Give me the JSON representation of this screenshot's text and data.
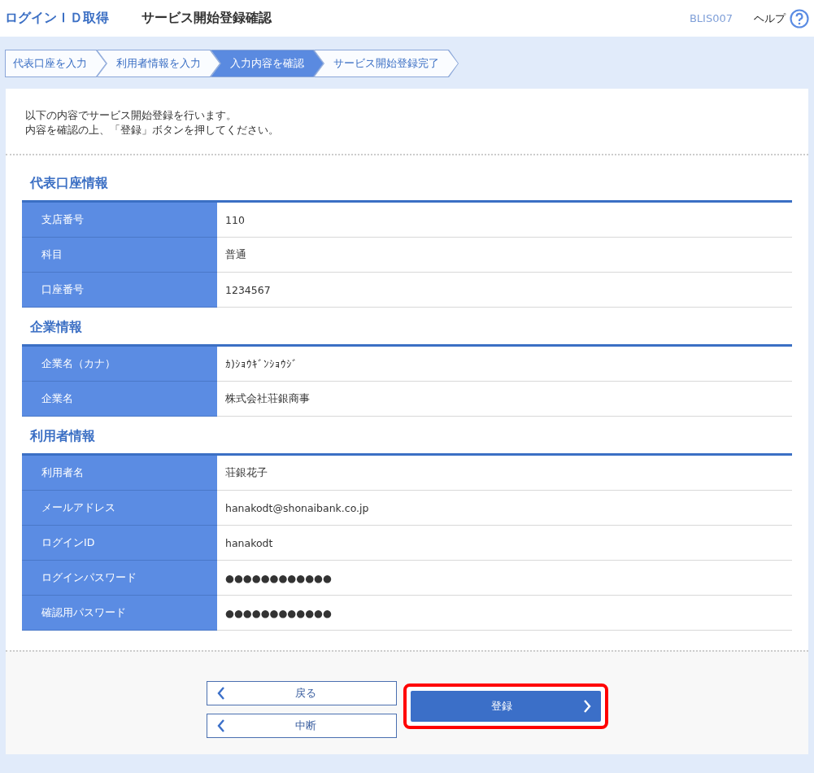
{
  "header": {
    "title": "ログインＩＤ取得",
    "subtitle": "サービス開始登録確認",
    "screen_id": "BLIS007",
    "help": "ヘルプ"
  },
  "steps": [
    {
      "label": "代表口座を入力",
      "selected": false
    },
    {
      "label": "利用者情報を入力",
      "selected": false
    },
    {
      "label": "入力内容を確認",
      "selected": true
    },
    {
      "label": "サービス開始登録完了",
      "selected": false
    }
  ],
  "intro": [
    "以下の内容でサービス開始登録を行います。",
    "内容を確認の上、「登録」ボタンを押してください。"
  ],
  "sections": [
    {
      "title": "代表口座情報",
      "rows": [
        {
          "label": "支店番号",
          "value": "110"
        },
        {
          "label": "科目",
          "value": "普通"
        },
        {
          "label": "口座番号",
          "value": "1234567"
        }
      ]
    },
    {
      "title": "企業情報",
      "rows": [
        {
          "label": "企業名（カナ）",
          "value": "ｶ)ｼｮｳｷﾞﾝｼｮｳｼﾞ"
        },
        {
          "label": "企業名",
          "value": "株式会社荘銀商事"
        }
      ]
    },
    {
      "title": "利用者情報",
      "rows": [
        {
          "label": "利用者名",
          "value": "荘銀花子"
        },
        {
          "label": "メールアドレス",
          "value": "hanakodt@shonaibank.co.jp"
        },
        {
          "label": "ログインID",
          "value": "hanakodt"
        },
        {
          "label": "ログインパスワード",
          "value": "●●●●●●●●●●●●"
        },
        {
          "label": "確認用パスワード",
          "value": "●●●●●●●●●●●●"
        }
      ]
    }
  ],
  "buttons": {
    "back": "戻る",
    "cancel": "中断",
    "register": "登録",
    "register_highlighted": true
  }
}
